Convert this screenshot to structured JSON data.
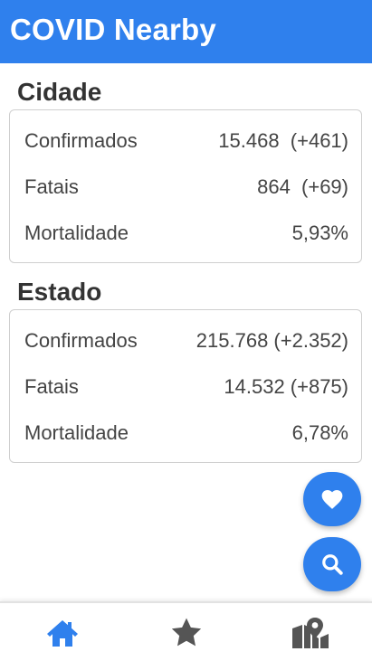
{
  "app": {
    "title": "COVID Nearby"
  },
  "colors": {
    "primary": "#2f80ed",
    "icon_inactive": "#555555"
  },
  "city": {
    "title": "Cidade",
    "rows": [
      {
        "label": "Confirmados",
        "value": "15.468  (+461)"
      },
      {
        "label": "Fatais",
        "value": "864  (+69)"
      },
      {
        "label": "Mortalidade",
        "value": "5,93%"
      }
    ]
  },
  "state": {
    "title": "Estado",
    "rows": [
      {
        "label": "Confirmados",
        "value": "215.768 (+2.352)"
      },
      {
        "label": "Fatais",
        "value": "14.532 (+875)"
      },
      {
        "label": "Mortalidade",
        "value": "6,78%"
      }
    ]
  },
  "fabs": [
    {
      "name": "favorite",
      "icon": "heart-icon"
    },
    {
      "name": "search",
      "icon": "search-icon"
    }
  ],
  "bottom_nav": [
    {
      "name": "home",
      "icon": "home-icon",
      "active": true
    },
    {
      "name": "favorites",
      "icon": "star-icon",
      "active": false
    },
    {
      "name": "map",
      "icon": "map-marker-icon",
      "active": false
    }
  ]
}
